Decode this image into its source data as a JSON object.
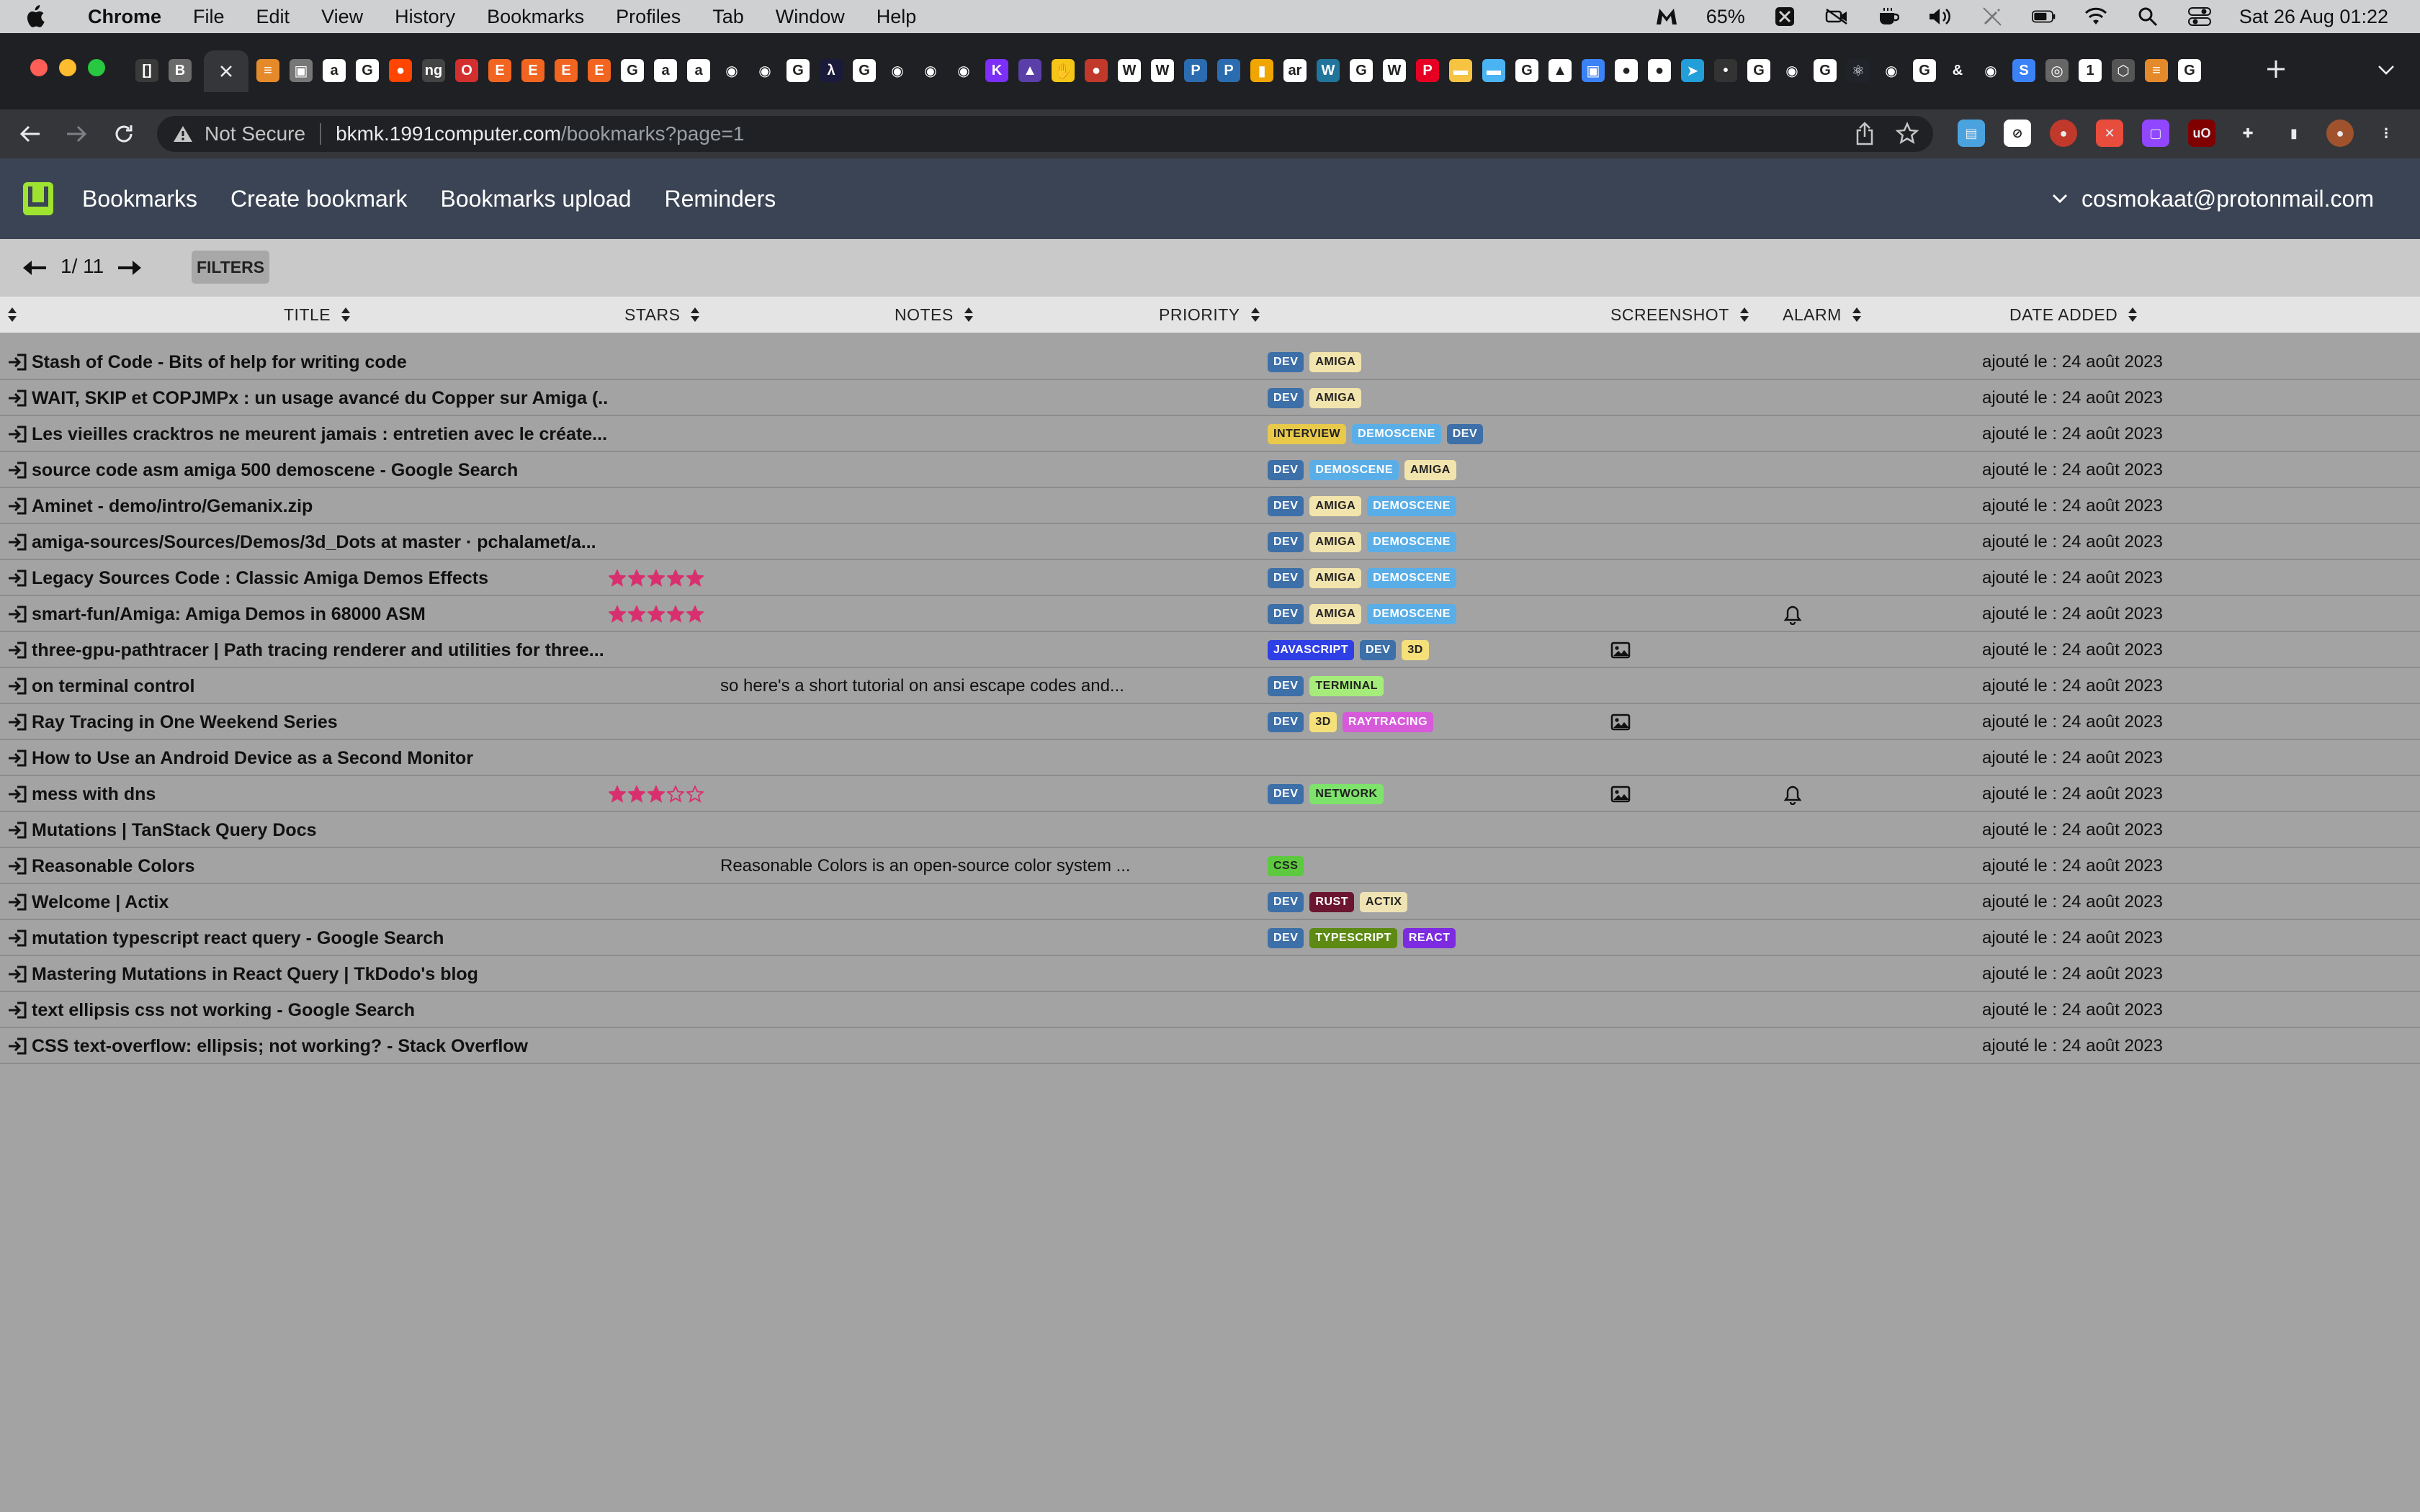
{
  "menubar": {
    "app_name": "Chrome",
    "items": [
      "File",
      "Edit",
      "View",
      "History",
      "Bookmarks",
      "Profiles",
      "Tab",
      "Window",
      "Help"
    ],
    "battery": "65%",
    "datetime": "Sat 26 Aug  01:22"
  },
  "browser": {
    "tab_favicons": [
      {
        "icon": "brackets",
        "bg": "#3a3a3a",
        "glyph": "[]"
      },
      {
        "icon": "bookmark-b",
        "bg": "#6b6b6b",
        "glyph": "B"
      },
      {
        "icon": "stack",
        "bg": "#e58a2b",
        "glyph": "≡"
      },
      {
        "icon": "image",
        "bg": "#777",
        "glyph": "▣"
      },
      {
        "icon": "amazon",
        "bg": "#ffffff",
        "glyph": "a"
      },
      {
        "icon": "google",
        "bg": "#ffffff",
        "glyph": "G"
      },
      {
        "icon": "reddit",
        "bg": "#ff4500",
        "glyph": "●"
      },
      {
        "icon": "ng",
        "bg": "#444",
        "glyph": "ng"
      },
      {
        "icon": "opera",
        "bg": "#d32f2f",
        "glyph": "O"
      },
      {
        "icon": "etsy",
        "bg": "#f16521",
        "glyph": "E"
      },
      {
        "icon": "etsy",
        "bg": "#f16521",
        "glyph": "E"
      },
      {
        "icon": "etsy",
        "bg": "#f16521",
        "glyph": "E"
      },
      {
        "icon": "etsy",
        "bg": "#f16521",
        "glyph": "E"
      },
      {
        "icon": "google",
        "bg": "#ffffff",
        "glyph": "G"
      },
      {
        "icon": "amazon",
        "bg": "#ffffff",
        "glyph": "a"
      },
      {
        "icon": "amazon",
        "bg": "#ffffff",
        "glyph": "a"
      },
      {
        "icon": "github",
        "bg": "#1f2023",
        "glyph": "◉"
      },
      {
        "icon": "github",
        "bg": "#1f2023",
        "glyph": "◉"
      },
      {
        "icon": "google",
        "bg": "#ffffff",
        "glyph": "G"
      },
      {
        "icon": "lambda",
        "bg": "#1a1a3a",
        "glyph": "λ"
      },
      {
        "icon": "google",
        "bg": "#ffffff",
        "glyph": "G"
      },
      {
        "icon": "github",
        "bg": "#1f2023",
        "glyph": "◉"
      },
      {
        "icon": "github",
        "bg": "#1f2023",
        "glyph": "◉"
      },
      {
        "icon": "github",
        "bg": "#1f2023",
        "glyph": "◉"
      },
      {
        "icon": "k",
        "bg": "#7b2ff7",
        "glyph": "K"
      },
      {
        "icon": "rocket",
        "bg": "#5b3fa8",
        "glyph": "▲"
      },
      {
        "icon": "hand",
        "bg": "#f5c518",
        "glyph": "✋"
      },
      {
        "icon": "avatar",
        "bg": "#c0392b",
        "glyph": "●"
      },
      {
        "icon": "wikipedia",
        "bg": "#ffffff",
        "glyph": "W"
      },
      {
        "icon": "wikipedia",
        "bg": "#ffffff",
        "glyph": "W"
      },
      {
        "icon": "pic",
        "bg": "#2b6cb0",
        "glyph": "P"
      },
      {
        "icon": "pic",
        "bg": "#2b6cb0",
        "glyph": "P"
      },
      {
        "icon": "bars",
        "bg": "#f0a500",
        "glyph": "▮"
      },
      {
        "icon": "ar",
        "bg": "#ffffff",
        "glyph": "ar"
      },
      {
        "icon": "wordpress",
        "bg": "#21759b",
        "glyph": "W"
      },
      {
        "icon": "google",
        "bg": "#ffffff",
        "glyph": "G"
      },
      {
        "icon": "wikipedia",
        "bg": "#ffffff",
        "glyph": "W"
      },
      {
        "icon": "pinterest",
        "bg": "#e60023",
        "glyph": "P"
      },
      {
        "icon": "folder",
        "bg": "#f6c343",
        "glyph": "▬"
      },
      {
        "icon": "folder",
        "bg": "#4ab3f4",
        "glyph": "▬"
      },
      {
        "icon": "google",
        "bg": "#ffffff",
        "glyph": "G"
      },
      {
        "icon": "drive",
        "bg": "#ffffff",
        "glyph": "▲"
      },
      {
        "icon": "picture",
        "bg": "#3b82f6",
        "glyph": "▣"
      },
      {
        "icon": "flickr",
        "bg": "#ffffff",
        "glyph": "●"
      },
      {
        "icon": "flickr",
        "bg": "#ffffff",
        "glyph": "●"
      },
      {
        "icon": "telegram",
        "bg": "#229ed9",
        "glyph": "➤"
      },
      {
        "icon": "dot",
        "bg": "#333",
        "glyph": "•"
      },
      {
        "icon": "google",
        "bg": "#ffffff",
        "glyph": "G"
      },
      {
        "icon": "github",
        "bg": "#1f2023",
        "glyph": "◉"
      },
      {
        "icon": "google",
        "bg": "#ffffff",
        "glyph": "G"
      },
      {
        "icon": "react",
        "bg": "#20232a",
        "glyph": "⚛"
      },
      {
        "icon": "github",
        "bg": "#1f2023",
        "glyph": "◉"
      },
      {
        "icon": "google",
        "bg": "#ffffff",
        "glyph": "G"
      },
      {
        "icon": "ampersand",
        "bg": "#1f2023",
        "glyph": "&"
      },
      {
        "icon": "github",
        "bg": "#1f2023",
        "glyph": "◉"
      },
      {
        "icon": "s",
        "bg": "#3b82f6",
        "glyph": "S"
      },
      {
        "icon": "globe",
        "bg": "#666",
        "glyph": "◎"
      },
      {
        "icon": "note",
        "bg": "#ffffff",
        "glyph": "1"
      },
      {
        "icon": "box",
        "bg": "#555",
        "glyph": "⬡"
      },
      {
        "icon": "stack",
        "bg": "#e58a2b",
        "glyph": "≡"
      },
      {
        "icon": "google",
        "bg": "#ffffff",
        "glyph": "G"
      }
    ],
    "address": {
      "security": "Not Secure",
      "host": "bkmk.1991computer.com",
      "path": "/bookmarks?page=1"
    },
    "extensions": [
      {
        "icon": "tab-manager",
        "bg": "#4aa3df",
        "glyph": "▤"
      },
      {
        "icon": "compass",
        "bg": "#ffffff",
        "glyph": "⊘"
      },
      {
        "icon": "record",
        "bg": "#c0392b",
        "glyph": "●"
      },
      {
        "icon": "x-close",
        "bg": "#e74c3c",
        "glyph": "✕"
      },
      {
        "icon": "twitch",
        "bg": "#9146ff",
        "glyph": "▢"
      },
      {
        "icon": "ublock",
        "bg": "#800000",
        "glyph": "uO"
      },
      {
        "icon": "puzzle",
        "bg": "#35363a",
        "glyph": "✚"
      },
      {
        "icon": "sidepanel",
        "bg": "#35363a",
        "glyph": "▮"
      },
      {
        "icon": "profile-avatar",
        "bg": "#a0522d",
        "glyph": "●"
      },
      {
        "icon": "kebab-menu",
        "bg": "#35363a",
        "glyph": "⋮"
      }
    ]
  },
  "nav": {
    "links": [
      "Bookmarks",
      "Create bookmark",
      "Bookmarks upload",
      "Reminders"
    ],
    "user_email": "cosmokaat@protonmail.com"
  },
  "pager": {
    "indicator": "1/ 11",
    "filters_label": "FILTERS"
  },
  "columns": {
    "title": "TITLE",
    "stars": "STARS",
    "notes": "NOTES",
    "priority": "PRIORITY",
    "screenshot": "SCREENSHOT",
    "alarm": "ALARM",
    "date_added": "DATE ADDED"
  },
  "tag_colors": {
    "DEV": {
      "bg": "#3d6fa8",
      "fg": "#ffffff"
    },
    "AMIGA": {
      "bg": "#f2e4ad",
      "fg": "#222222"
    },
    "INTERVIEW": {
      "bg": "#e8c94a",
      "fg": "#222222"
    },
    "DEMOSCENE": {
      "bg": "#5aaee8",
      "fg": "#ffffff"
    },
    "JAVASCRIPT": {
      "bg": "#2f3fe6",
      "fg": "#ffffff"
    },
    "3D": {
      "bg": "#f5e07a",
      "fg": "#222222"
    },
    "TERMINAL": {
      "bg": "#a6ec7a",
      "fg": "#222222"
    },
    "RAYTRACING": {
      "bg": "#d65ad9",
      "fg": "#ffffff"
    },
    "NETWORK": {
      "bg": "#7de36b",
      "fg": "#222222"
    },
    "CSS": {
      "bg": "#5cc93e",
      "fg": "#222222"
    },
    "RUST": {
      "bg": "#6b1530",
      "fg": "#ffffff"
    },
    "ACTIX": {
      "bg": "#efe3b4",
      "fg": "#222222"
    },
    "TYPESCRIPT": {
      "bg": "#5d8a12",
      "fg": "#ffffff"
    },
    "REACT": {
      "bg": "#7c2be0",
      "fg": "#ffffff"
    }
  },
  "bookmarks": [
    {
      "title": "Stash of Code - Bits of help for writing code",
      "stars": 0,
      "notes": "",
      "tags": [
        "DEV",
        "AMIGA"
      ],
      "screenshot": false,
      "alarm": false,
      "date": "ajouté le : 24 août 2023"
    },
    {
      "title": "WAIT, SKIP et COPJMPx : un usage avancé du Copper sur Amiga (...",
      "stars": 0,
      "notes": "",
      "tags": [
        "DEV",
        "AMIGA"
      ],
      "screenshot": false,
      "alarm": false,
      "date": "ajouté le : 24 août 2023"
    },
    {
      "title": "Les vieilles cracktros ne meurent jamais : entretien avec le créate...",
      "stars": 0,
      "notes": "",
      "tags": [
        "INTERVIEW",
        "DEMOSCENE",
        "DEV"
      ],
      "screenshot": false,
      "alarm": false,
      "date": "ajouté le : 24 août 2023"
    },
    {
      "title": "source code asm amiga 500 demoscene - Google Search",
      "stars": 0,
      "notes": "",
      "tags": [
        "DEV",
        "DEMOSCENE",
        "AMIGA"
      ],
      "screenshot": false,
      "alarm": false,
      "date": "ajouté le : 24 août 2023"
    },
    {
      "title": "Aminet - demo/intro/Gemanix.zip",
      "stars": 0,
      "notes": "",
      "tags": [
        "DEV",
        "AMIGA",
        "DEMOSCENE"
      ],
      "screenshot": false,
      "alarm": false,
      "date": "ajouté le : 24 août 2023"
    },
    {
      "title": "amiga-sources/Sources/Demos/3d_Dots at master · pchalamet/a...",
      "stars": 0,
      "notes": "",
      "tags": [
        "DEV",
        "AMIGA",
        "DEMOSCENE"
      ],
      "screenshot": false,
      "alarm": false,
      "date": "ajouté le : 24 août 2023"
    },
    {
      "title": "Legacy Sources Code : Classic Amiga Demos Effects",
      "stars": 5,
      "notes": "",
      "tags": [
        "DEV",
        "AMIGA",
        "DEMOSCENE"
      ],
      "screenshot": false,
      "alarm": false,
      "date": "ajouté le : 24 août 2023"
    },
    {
      "title": "smart-fun/Amiga: Amiga Demos in 68000 ASM",
      "stars": 5,
      "notes": "",
      "tags": [
        "DEV",
        "AMIGA",
        "DEMOSCENE"
      ],
      "screenshot": false,
      "alarm": true,
      "date": "ajouté le : 24 août 2023"
    },
    {
      "title": "three-gpu-pathtracer | Path tracing renderer and utilities for three...",
      "stars": 0,
      "notes": "",
      "tags": [
        "JAVASCRIPT",
        "DEV",
        "3D"
      ],
      "screenshot": true,
      "alarm": false,
      "date": "ajouté le : 24 août 2023"
    },
    {
      "title": "on terminal control",
      "stars": 0,
      "notes": "so here's a short tutorial on ansi escape codes and...",
      "tags": [
        "DEV",
        "TERMINAL"
      ],
      "screenshot": false,
      "alarm": false,
      "date": "ajouté le : 24 août 2023"
    },
    {
      "title": "Ray Tracing in One Weekend Series",
      "stars": 0,
      "notes": "",
      "tags": [
        "DEV",
        "3D",
        "RAYTRACING"
      ],
      "screenshot": true,
      "alarm": false,
      "date": "ajouté le : 24 août 2023"
    },
    {
      "title": "How to Use an Android Device as a Second Monitor",
      "stars": 0,
      "notes": "",
      "tags": [],
      "screenshot": false,
      "alarm": false,
      "date": "ajouté le : 24 août 2023"
    },
    {
      "title": "mess with dns",
      "stars": 3,
      "notes": "",
      "tags": [
        "DEV",
        "NETWORK"
      ],
      "screenshot": true,
      "alarm": true,
      "date": "ajouté le : 24 août 2023"
    },
    {
      "title": "Mutations | TanStack Query Docs",
      "stars": 0,
      "notes": "",
      "tags": [],
      "screenshot": false,
      "alarm": false,
      "date": "ajouté le : 24 août 2023"
    },
    {
      "title": "Reasonable Colors",
      "stars": 0,
      "notes": "Reasonable Colors is an open-source color system ...",
      "tags": [
        "CSS"
      ],
      "screenshot": false,
      "alarm": false,
      "date": "ajouté le : 24 août 2023"
    },
    {
      "title": "Welcome | Actix",
      "stars": 0,
      "notes": "",
      "tags": [
        "DEV",
        "RUST",
        "ACTIX"
      ],
      "screenshot": false,
      "alarm": false,
      "date": "ajouté le : 24 août 2023"
    },
    {
      "title": "mutation typescript react query - Google Search",
      "stars": 0,
      "notes": "",
      "tags": [
        "DEV",
        "TYPESCRIPT",
        "REACT"
      ],
      "screenshot": false,
      "alarm": false,
      "date": "ajouté le : 24 août 2023"
    },
    {
      "title": "Mastering Mutations in React Query | TkDodo's blog",
      "stars": 0,
      "notes": "",
      "tags": [],
      "screenshot": false,
      "alarm": false,
      "date": "ajouté le : 24 août 2023"
    },
    {
      "title": "text ellipsis css not working - Google Search",
      "stars": 0,
      "notes": "",
      "tags": [],
      "screenshot": false,
      "alarm": false,
      "date": "ajouté le : 24 août 2023"
    },
    {
      "title": "CSS text-overflow: ellipsis; not working? - Stack Overflow",
      "stars": 0,
      "notes": "",
      "tags": [],
      "screenshot": false,
      "alarm": false,
      "date": "ajouté le : 24 août 2023"
    }
  ]
}
